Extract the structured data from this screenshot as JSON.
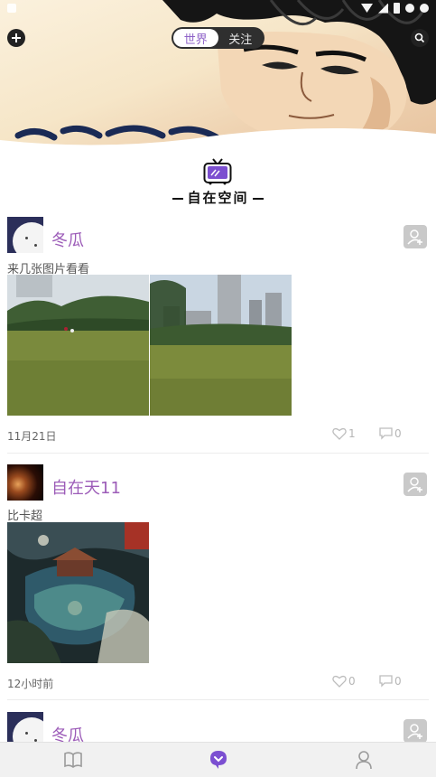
{
  "header": {
    "tabs": [
      {
        "label": "世界",
        "active": true
      },
      {
        "label": "关注",
        "active": false
      }
    ],
    "add_icon": "plus-circle-icon",
    "search_icon": "search-icon"
  },
  "logo": {
    "text": "自在空间",
    "icon": "tv-icon"
  },
  "posts": [
    {
      "username": "冬瓜",
      "caption": "来几张图片看看",
      "time": "11月21日",
      "likes": "1",
      "comments": "0",
      "photos": [
        "lawn-photo",
        "city-lawn-photo"
      ]
    },
    {
      "username": "自在天11",
      "caption": "比卡超",
      "time": "12小时前",
      "likes": "0",
      "comments": "0",
      "photos": [
        "fantasy-art-photo"
      ]
    },
    {
      "username": "冬瓜"
    }
  ],
  "bottom_nav": [
    {
      "icon": "book-icon",
      "active": false
    },
    {
      "icon": "chat-bubble-icon",
      "active": true
    },
    {
      "icon": "user-icon",
      "active": false
    }
  ],
  "colors": {
    "accent": "#8e62c8",
    "username": "#9c5cb8",
    "nav_active": "#7b4fd1",
    "nav_inactive": "#9a9a9a"
  }
}
